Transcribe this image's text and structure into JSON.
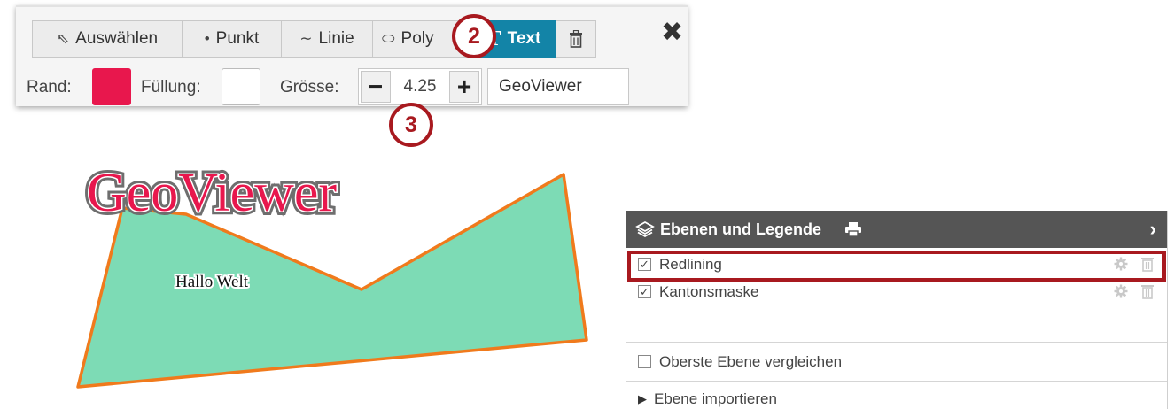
{
  "toolbar": {
    "tools": [
      {
        "label": "Auswählen",
        "icon": "cursor-select-icon",
        "glyph": "⇖",
        "active": false
      },
      {
        "label": "Punkt",
        "icon": "point-icon",
        "glyph": "•",
        "active": false
      },
      {
        "label": "Linie",
        "icon": "line-icon",
        "glyph": "∼",
        "active": false
      },
      {
        "label": "Poly",
        "icon": "polygon-icon",
        "glyph": "⬭",
        "active": false
      },
      {
        "label": "Text",
        "icon": "text-icon",
        "glyph": "T",
        "active": true
      },
      {
        "label": "",
        "icon": "trash-icon",
        "glyph": "🗑",
        "active": false
      }
    ],
    "close_glyph": "✖",
    "border_label": "Rand:",
    "border_color": "#e8174d",
    "fill_label": "Füllung:",
    "fill_color": "#ffffff",
    "size_label": "Grösse:",
    "size_minus": "−",
    "size_value": "4.25",
    "size_plus": "+",
    "text_value": "GeoViewer",
    "active_color": "#1384a7"
  },
  "markers": {
    "step_2": "2",
    "step_3": "3",
    "color": "#a8191f"
  },
  "map": {
    "big_label": "GeoViewer",
    "small_label": "Hallo Welt",
    "polygon_fill": "#7ddbb5",
    "polygon_stroke": "#f07a1c",
    "label_color": "#e8174d"
  },
  "layer_panel": {
    "title": "Ebenen und Legende",
    "chevron": "›",
    "layers": [
      {
        "name": "Redlining",
        "checked": true,
        "highlighted": true
      },
      {
        "name": "Kantonsmaske",
        "checked": true,
        "highlighted": false
      }
    ],
    "compare_label": "Oberste Ebene vergleichen",
    "import_label": "Ebene importieren",
    "header_color": "#555555"
  }
}
